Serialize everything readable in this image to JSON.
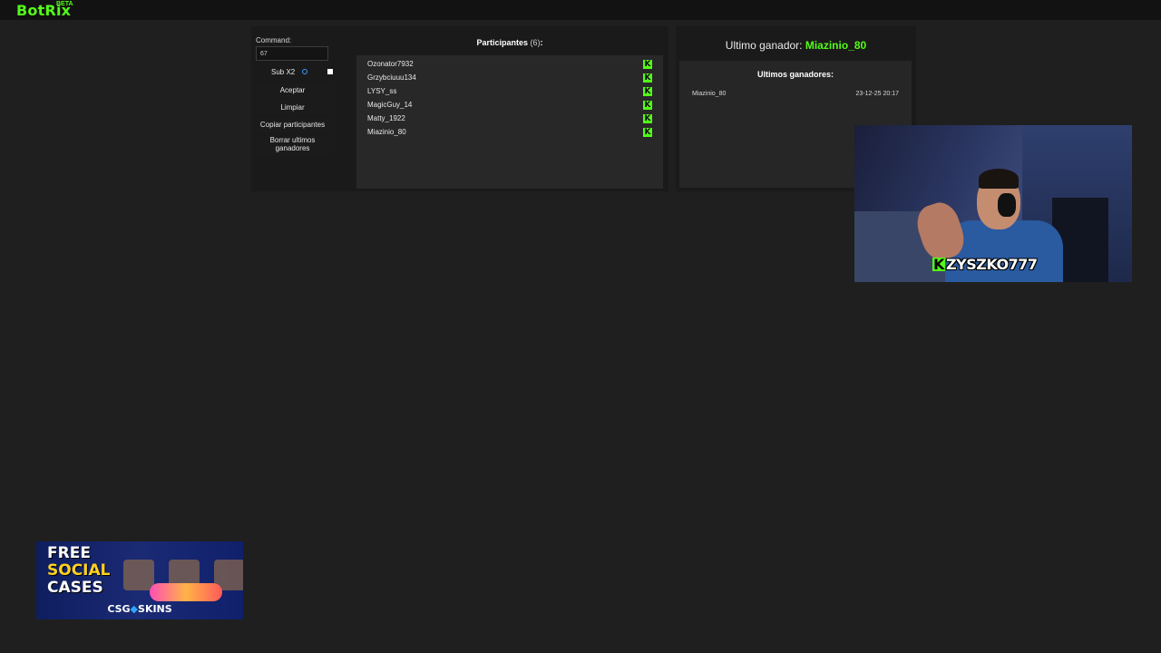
{
  "app": {
    "logo": "BotRix",
    "logo_badge": "BETA"
  },
  "controls": {
    "command_label": "Command:",
    "command_value": "67",
    "sub_label": "Sub X2",
    "sub_checked": false,
    "buttons": {
      "accept": "Aceptar",
      "clear": "Limpiar",
      "copy": "Copiar participantes",
      "delete_winners": "Borrar ultimos ganadores"
    }
  },
  "participants": {
    "title": "Participantes",
    "count": "(6)",
    "colon": ":",
    "items": [
      {
        "name": "Ozonator7932",
        "platform_icon": "kick-icon"
      },
      {
        "name": "Grzybciuuu134",
        "platform_icon": "kick-icon"
      },
      {
        "name": "LYSY_ss",
        "platform_icon": "kick-icon"
      },
      {
        "name": "MagicGuy_14",
        "platform_icon": "kick-icon"
      },
      {
        "name": "Matty_1922",
        "platform_icon": "kick-icon"
      },
      {
        "name": "Miazinio_80",
        "platform_icon": "kick-icon"
      }
    ]
  },
  "winner": {
    "label": "Ultimo ganador:",
    "name": "Miazinio_80",
    "history_title": "Ultimos ganadores:",
    "history": [
      {
        "name": "Miazinio_80",
        "date": "23-12-25 20:17"
      }
    ]
  },
  "webcam": {
    "streamer_name": "ZYSZKO777",
    "badge": "K"
  },
  "ad": {
    "line1": "FREE",
    "line2": "SOCIAL",
    "line3": "CASES",
    "brand_left": "CSG",
    "brand_dot": "◆",
    "brand_right": "SKINS"
  },
  "colors": {
    "accent": "#53fc18",
    "background": "#1f1f1f",
    "panel": "#282828",
    "info": "#3b9bff"
  }
}
